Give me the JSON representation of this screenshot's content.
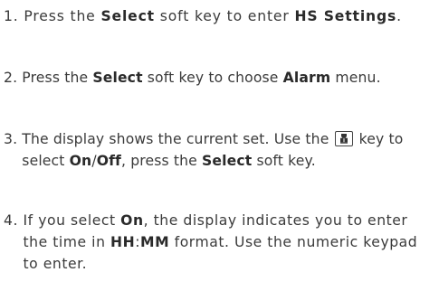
{
  "steps": [
    {
      "num": "1. ",
      "t1": "Press the ",
      "b1": "Select",
      "t2": " soft key to enter ",
      "b2": "HS Settings",
      "t3": "."
    },
    {
      "num": "2. ",
      "t1": "Press the ",
      "b1": "Select",
      "t2": " soft key to choose ",
      "b2": "Alarm",
      "t3": " menu."
    },
    {
      "num": "3. ",
      "t1": "The display shows the current set. Use the ",
      "icon": "book-key-icon",
      "t2": " key to select ",
      "b1": "On",
      "slash": "/",
      "b2": "Off",
      "t3": ", press the ",
      "b3": "Select",
      "t4": " soft key."
    },
    {
      "num": "4. ",
      "t1": "If you select ",
      "b1": "On",
      "t2": ", the display indicates you to enter the time in ",
      "b2": "HH",
      "colon": ":",
      "b3": "MM",
      "t3": " format. Use the numeric keypad to enter."
    }
  ]
}
